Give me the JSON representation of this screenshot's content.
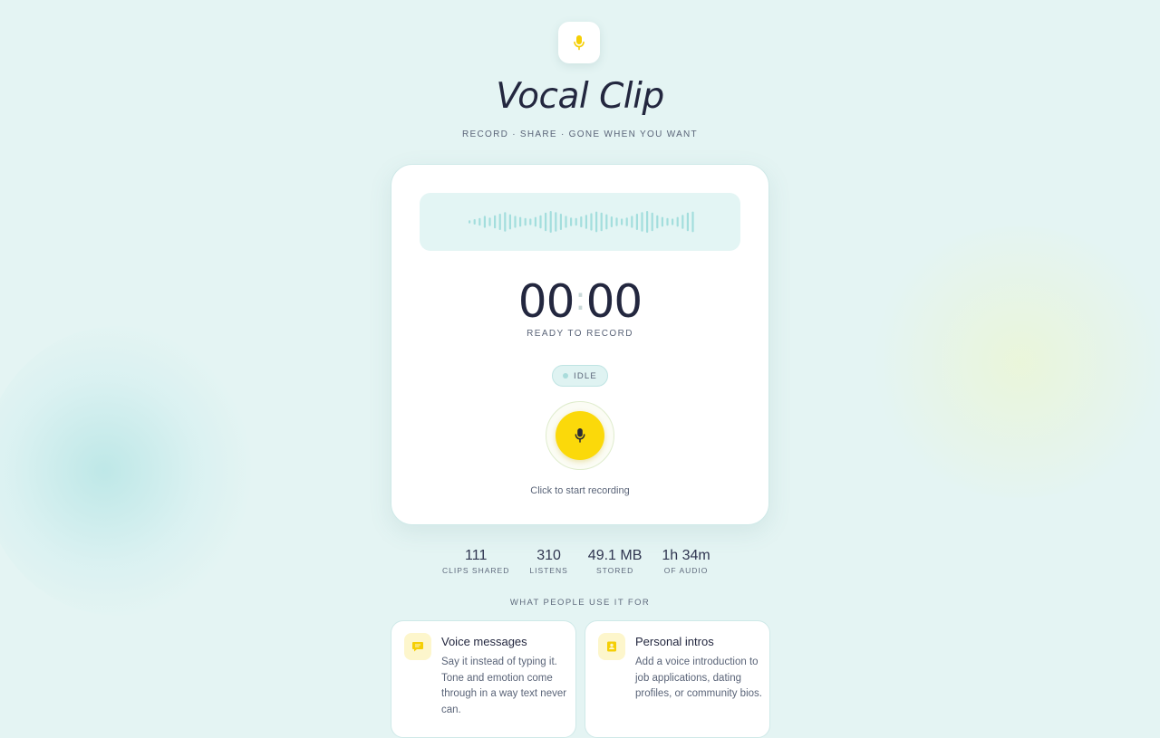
{
  "header": {
    "logo_icon": "mic-icon",
    "title": "Vocal Clip",
    "tagline": "RECORD · SHARE · GONE WHEN YOU WANT"
  },
  "recorder": {
    "waveform_levels": [
      0.15,
      0.25,
      0.35,
      0.55,
      0.4,
      0.6,
      0.75,
      0.9,
      0.7,
      0.55,
      0.45,
      0.35,
      0.3,
      0.45,
      0.6,
      0.85,
      1.0,
      0.9,
      0.75,
      0.55,
      0.4,
      0.35,
      0.5,
      0.65,
      0.8,
      0.95,
      0.85,
      0.7,
      0.5,
      0.4,
      0.3,
      0.4,
      0.55,
      0.75,
      0.9,
      1.0,
      0.85,
      0.6,
      0.45,
      0.35,
      0.3,
      0.45,
      0.65,
      0.85,
      0.95
    ],
    "timer_minutes": "00",
    "timer_seconds": "00",
    "timer_status": "READY TO RECORD",
    "state_badge": "IDLE",
    "record_button_icon": "mic-icon",
    "hint": "Click to start recording"
  },
  "stats": [
    {
      "value": "111",
      "label": "CLIPS SHARED"
    },
    {
      "value": "310",
      "label": "LISTENS"
    },
    {
      "value": "49.1 MB",
      "label": "STORED"
    },
    {
      "value": "1h 34m",
      "label": "OF AUDIO"
    }
  ],
  "use_cases": {
    "heading": "WHAT PEOPLE USE IT FOR",
    "items": [
      {
        "icon": "chat-bubble-icon",
        "title": "Voice messages",
        "description": "Say it instead of typing it. Tone and emotion come through in a way text never can."
      },
      {
        "icon": "contact-card-icon",
        "title": "Personal intros",
        "description": "Add a voice introduction to job applications, dating profiles, or community bios."
      }
    ]
  },
  "colors": {
    "accent_yellow": "#fbd90a",
    "background": "#e4f4f3",
    "wave_bar": "#a3dedd"
  }
}
